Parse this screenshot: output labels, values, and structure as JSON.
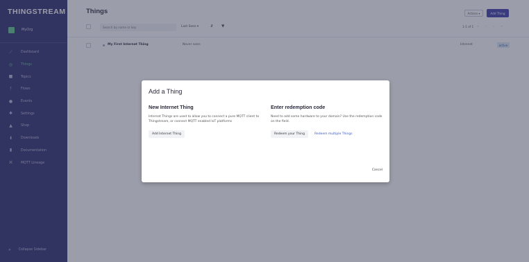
{
  "sidebar": {
    "brand": "THINGSTREAM",
    "org": "MyOrg",
    "items": [
      {
        "label": "Dashboard",
        "icon": "chart-icon",
        "glyph": "⟋"
      },
      {
        "label": "Things",
        "icon": "globe-icon",
        "glyph": "◎"
      },
      {
        "label": "Topics",
        "icon": "tag-icon",
        "glyph": "■"
      },
      {
        "label": "Flows",
        "icon": "flow-icon",
        "glyph": "ᚡ"
      },
      {
        "label": "Events",
        "icon": "events-icon",
        "glyph": "●"
      },
      {
        "label": "Settings",
        "icon": "gear-icon",
        "glyph": "✱"
      },
      {
        "label": "Shop",
        "icon": "shop-icon",
        "glyph": "▲"
      },
      {
        "label": "Downloads",
        "icon": "download-icon",
        "glyph": "⬇"
      },
      {
        "label": "Documentation",
        "icon": "book-icon",
        "glyph": "▮"
      },
      {
        "label": "MQTT Lineage",
        "icon": "rss-icon",
        "glyph": "ℵ"
      }
    ],
    "collapse_label": "Collapse Sidebar",
    "collapse_glyph": "«"
  },
  "header": {
    "title": "Things",
    "actions_label": "Actions ▾",
    "add_label": "Add Thing"
  },
  "toolbar": {
    "search_placeholder": "Search by name or key",
    "sort_label": "Last Seen ▾",
    "sort_dir": "⇵",
    "filter_glyph": "▼",
    "pager_text": "1-1 of 1",
    "pager_arrows": "« ‹ › »"
  },
  "rows": [
    {
      "name": "My First Internet Thing",
      "seen": "Never seen",
      "type": "Internet",
      "status": "active"
    }
  ],
  "modal": {
    "title": "Add a Thing",
    "left": {
      "heading": "New Internet Thing",
      "description": "Internet Things are used to allow you to connect a pure MQTT client to Thingstream, or connect MQTT enabled IoT platforms",
      "button": "Add Internet Thing"
    },
    "right": {
      "heading": "Enter redemption code",
      "description": "Need to add some hardware to your domain? Use the redemption code on the field.",
      "button": "Redeem your Thing",
      "link": "Redeem multiple Things"
    },
    "cancel": "Cancel"
  },
  "colors": {
    "sidebar": "#2b2a6b",
    "accent": "#3d3aa8",
    "active_green": "#5fc38e"
  }
}
